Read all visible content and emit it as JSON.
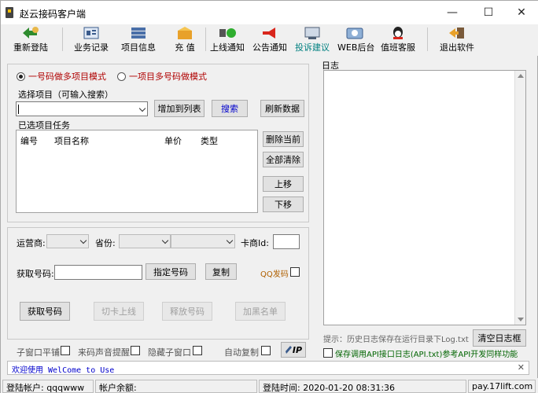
{
  "window": {
    "title": "赵云接码客户端",
    "minimize": "—",
    "maximize": "☐",
    "close": "✕"
  },
  "toolbar": [
    {
      "label": "重新登陆",
      "icon": "relogin-icon"
    },
    {
      "label": "业务记录",
      "icon": "records-icon"
    },
    {
      "label": "项目信息",
      "icon": "project-info-icon"
    },
    {
      "label": "充 值",
      "icon": "recharge-icon"
    },
    {
      "label": "上线通知",
      "icon": "online-notice-icon"
    },
    {
      "label": "公告通知",
      "icon": "announcement-icon"
    },
    {
      "label": "投诉建议",
      "icon": "feedback-icon"
    },
    {
      "label": "WEB后台",
      "icon": "web-backend-icon"
    },
    {
      "label": "值班客服",
      "icon": "support-icon"
    },
    {
      "label": "退出软件",
      "icon": "exit-icon"
    }
  ],
  "mode": {
    "option1": "一号码做多项目模式",
    "option2": "一项目多号码做模式",
    "selected": 1
  },
  "project": {
    "select_label": "选择项目（可输入搜索）",
    "search_value": "",
    "add_button": "增加到列表",
    "search_button": "搜索",
    "refresh_button": "刷新数据",
    "tasks_label": "已选项目任务",
    "columns": [
      "编号",
      "项目名称",
      "单价",
      "类型"
    ],
    "delete_current": "删除当前",
    "clear_all": "全部清除",
    "move_up": "上移",
    "move_down": "下移"
  },
  "carrier": {
    "operator_label": "运营商:",
    "province_label": "省份:",
    "card_id_label": "卡商Id:"
  },
  "number": {
    "label": "获取号码:",
    "specify_button": "指定号码",
    "copy_button": "复制",
    "qq_label": "QQ发码"
  },
  "actions": {
    "get_number": "获取号码",
    "card_online": "切卡上线",
    "release": "释放号码",
    "blacklist": "加黑名单"
  },
  "options": {
    "sub_window_tile": "子窗口平铺",
    "sound": "来码声音提醒",
    "hide_sub": "隐藏子窗口",
    "auto_copy": "自动复制",
    "ip_label": "IP"
  },
  "log": {
    "title": "日志",
    "hint": "提示：历史日志保存在运行目录下Log.txt",
    "clear_button": "清空日志框",
    "api_log": "保存调用API接口日志(API.txt)参考API开发同样功能"
  },
  "welcome": "欢迎使用 WelCome to Use",
  "status": {
    "account": "登陆帐户: qqqwww",
    "balance": "帐户余额:",
    "login_time": "登陆时间: 2020-01-20 08:31:36",
    "site": "pay.17lift.com"
  },
  "colors": {
    "accent_red": "#b00000",
    "link_blue": "#0000cc",
    "feedback_green": "#008080",
    "api_green": "#006400"
  }
}
